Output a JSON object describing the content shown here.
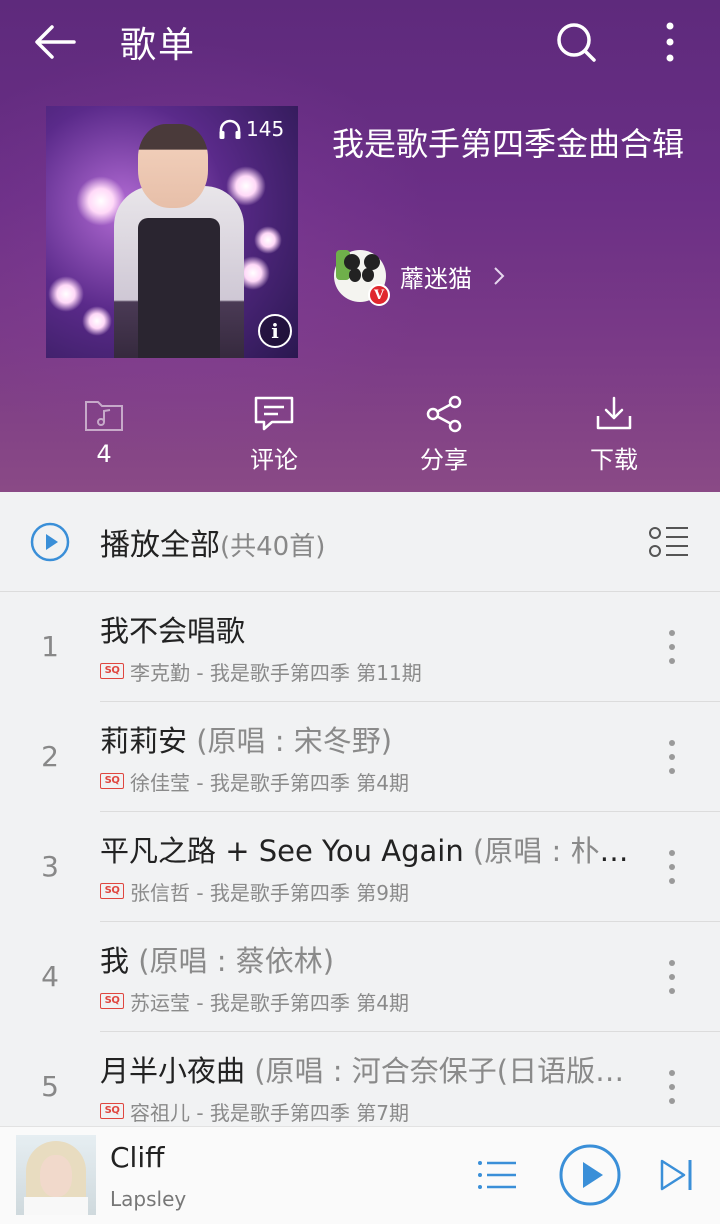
{
  "topbar": {
    "title": "歌单",
    "back_icon": "back-arrow-icon",
    "search_icon": "search-icon",
    "more_icon": "more-vertical-icon"
  },
  "playlist": {
    "title": "我是歌手第四季金曲合辑",
    "play_count": "145",
    "creator_name": "蘼迷猫",
    "verified_badge": "V"
  },
  "actions": {
    "collect_count": "4",
    "comment_label": "评论",
    "share_label": "分享",
    "download_label": "下载"
  },
  "list": {
    "play_all_label": "播放全部",
    "play_all_count": "(共40首)",
    "songs": [
      {
        "index": "1",
        "title": "我不会唱歌",
        "original": "",
        "quality": "SQ",
        "meta": "李克勤 - 我是歌手第四季 第11期"
      },
      {
        "index": "2",
        "title": "莉莉安",
        "original": " (原唱 : 宋冬野)",
        "quality": "SQ",
        "meta": "徐佳莹 - 我是歌手第四季 第4期"
      },
      {
        "index": "3",
        "title": "平凡之路 + See You Again",
        "original": " (原唱 : 朴树…",
        "quality": "SQ",
        "meta": "张信哲 - 我是歌手第四季 第9期"
      },
      {
        "index": "4",
        "title": "我",
        "original": " (原唱 : 蔡依林)",
        "quality": "SQ",
        "meta": "苏运莹 - 我是歌手第四季 第4期"
      },
      {
        "index": "5",
        "title": "月半小夜曲",
        "original": " (原唱 : 河合奈保子(日语版…",
        "quality": "SQ",
        "meta": "容祖儿 - 我是歌手第四季 第7期"
      }
    ]
  },
  "player": {
    "title": "Cliff",
    "artist": "Lapsley"
  },
  "colors": {
    "hero_purple": "#6b2f86",
    "accent_blue": "#3a8fd8",
    "sq_red": "#e0463f",
    "verified_red": "#e0282e"
  }
}
